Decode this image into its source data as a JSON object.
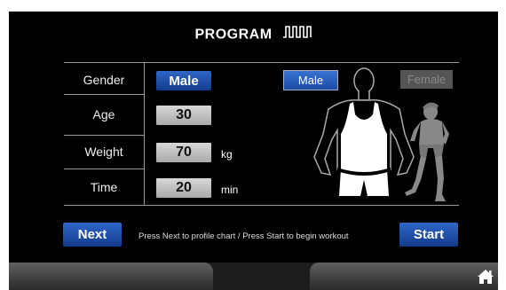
{
  "header": {
    "title": "PROGRAM"
  },
  "fields": [
    {
      "label": "Gender",
      "value": "Male",
      "unit": ""
    },
    {
      "label": "Age",
      "value": "30",
      "unit": ""
    },
    {
      "label": "Weight",
      "value": "70",
      "unit": "kg"
    },
    {
      "label": "Time",
      "value": "20",
      "unit": "min"
    }
  ],
  "gender_selector": {
    "male": "Male",
    "female": "Female",
    "selected": "Male"
  },
  "footer": {
    "next": "Next",
    "start": "Start",
    "message": "Press Next to profile chart  /  Press Start to begin workout"
  },
  "icons": {
    "program": "pulse-wave-icon",
    "home": "home-icon"
  },
  "colors": {
    "accent": "#1f54b4",
    "background": "#000000",
    "value_box": "#c4c4c4"
  }
}
